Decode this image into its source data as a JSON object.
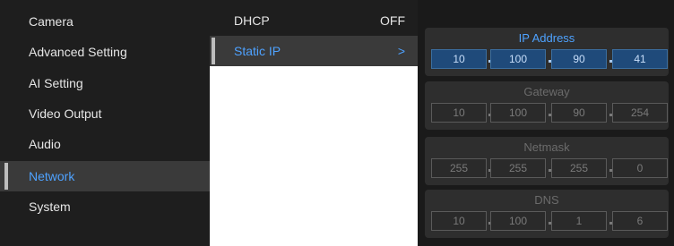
{
  "sidebar": {
    "items": [
      {
        "label": "Camera"
      },
      {
        "label": "Advanced Setting"
      },
      {
        "label": "AI Setting"
      },
      {
        "label": "Video Output"
      },
      {
        "label": "Audio"
      },
      {
        "label": "Network",
        "active": true
      },
      {
        "label": "System"
      }
    ]
  },
  "network": {
    "dhcp": {
      "label": "DHCP",
      "value": "OFF"
    },
    "static_ip": {
      "label": "Static IP",
      "arrow": ">"
    }
  },
  "static_ip_settings": {
    "ip_address": {
      "title": "IP Address",
      "octets": [
        "10",
        "100",
        "90",
        "41"
      ]
    },
    "gateway": {
      "title": "Gateway",
      "octets": [
        "10",
        "100",
        "90",
        "254"
      ]
    },
    "netmask": {
      "title": "Netmask",
      "octets": [
        "255",
        "255",
        "255",
        "0"
      ]
    },
    "dns": {
      "title": "DNS",
      "octets": [
        "10",
        "100",
        "1",
        "6"
      ]
    }
  },
  "colors": {
    "accent": "#4ea2ff",
    "selected_field": "#1f4a7a"
  }
}
